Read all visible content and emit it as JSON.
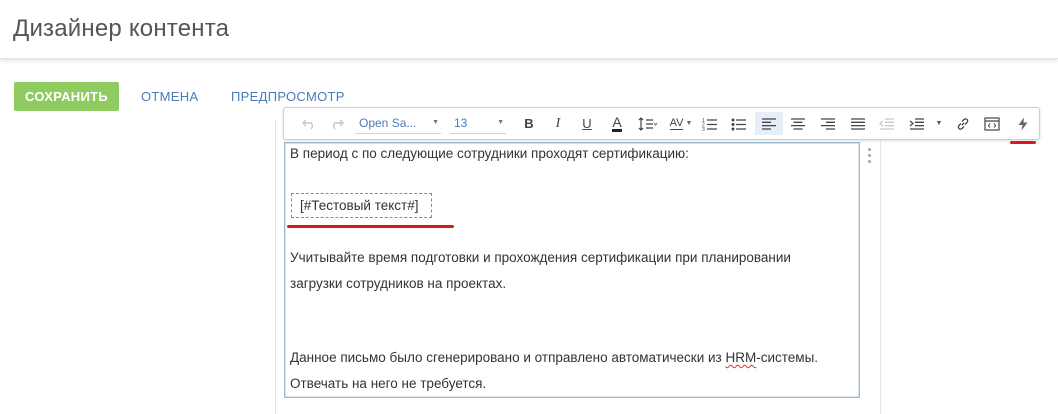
{
  "header": {
    "title": "Дизайнер контента"
  },
  "actions": {
    "save_label": "СОХРАНИТЬ",
    "cancel_label": "ОТМЕНА",
    "preview_label": "ПРЕДПРОСМОТР"
  },
  "toolbar": {
    "font_family": "Open Sa...",
    "font_size": "13",
    "bold": "B",
    "italic": "I",
    "underline": "U",
    "font_color": "A",
    "letter_spacing": "AV"
  },
  "content": {
    "line1": "В период с  по  следующие сотрудники проходят сертификацию:",
    "macro": "[#Тестовый текст#]",
    "line2": "Учитывайте время подготовки и прохождения сертификации при планировании",
    "line3": "загрузки сотрудников на проектах.",
    "line4_pre": "Данное письмо было сгенерировано и отправлено автоматически из ",
    "line4_word": "HRM",
    "line4_post": "-системы.",
    "line5": "Отвечать на него не требуется."
  },
  "colors": {
    "save_button": "#8ecb60",
    "link": "#4b7bb7",
    "annotation": "#d71920",
    "content_border": "#9dbcd4"
  }
}
